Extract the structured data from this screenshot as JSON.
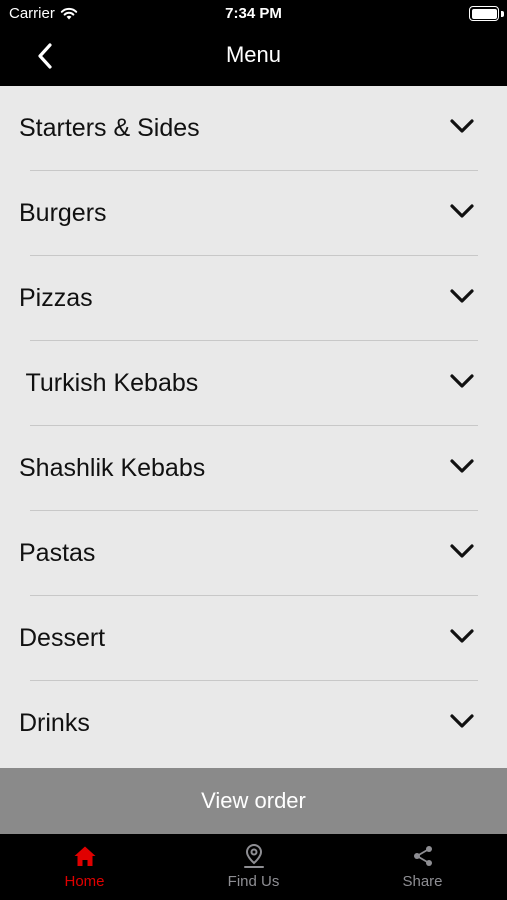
{
  "status_bar": {
    "carrier": "Carrier",
    "time": "7:34 PM"
  },
  "nav": {
    "title": "Menu",
    "back_icon": "chevron-left-icon"
  },
  "menu": {
    "items": [
      {
        "label": "Starters & Sides"
      },
      {
        "label": "Burgers"
      },
      {
        "label": "Pizzas"
      },
      {
        "label": " Turkish Kebabs"
      },
      {
        "label": "Shashlik Kebabs"
      },
      {
        "label": "Pastas"
      },
      {
        "label": "Dessert"
      },
      {
        "label": "Drinks"
      }
    ]
  },
  "view_order": {
    "label": "View order"
  },
  "tabs": [
    {
      "label": "Home",
      "icon": "home-icon",
      "active": true
    },
    {
      "label": "Find Us",
      "icon": "location-pin-icon",
      "active": false
    },
    {
      "label": "Share",
      "icon": "share-icon",
      "active": false
    }
  ],
  "colors": {
    "accent": "#e00000",
    "inactive": "#8e8e93",
    "list_bg": "#e9e9e9",
    "view_order_bg": "#8a8a8a"
  }
}
